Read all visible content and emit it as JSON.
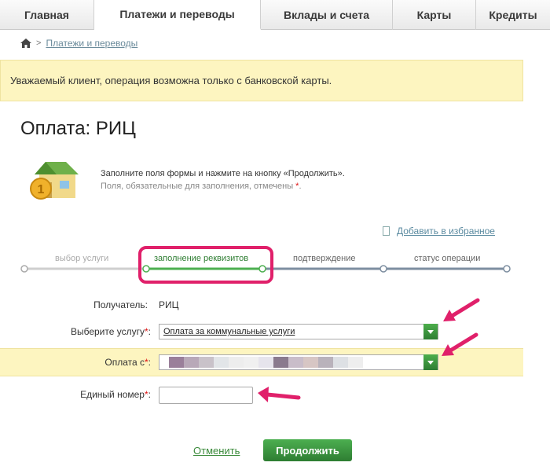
{
  "nav": {
    "tabs": [
      {
        "label": "Главная",
        "active": false
      },
      {
        "label": "Платежи и переводы",
        "active": true
      },
      {
        "label": "Вклады и счета",
        "active": false
      },
      {
        "label": "Карты",
        "active": false
      },
      {
        "label": "Кредиты",
        "active": false
      }
    ]
  },
  "breadcrumb": {
    "home_icon": "home-icon",
    "link": "Платежи и переводы"
  },
  "notice": "Уважаемый клиент, операция возможна только с банковской карты.",
  "page_title": "Оплата: РИЦ",
  "intro": {
    "icon": "house-coin-icon",
    "line1": "Заполните поля формы и нажмите на кнопку «Продолжить».",
    "line2": "Поля, обязательные для заполнения, отмечены",
    "required_mark": "*",
    "line2_end": "."
  },
  "favorite": {
    "icon": "bookmark-icon",
    "label": "Добавить в избранное"
  },
  "steps": [
    {
      "label": "выбор услуги",
      "state": "done"
    },
    {
      "label": "заполнение реквизитов",
      "state": "current"
    },
    {
      "label": "подтверждение",
      "state": "pending"
    },
    {
      "label": "статус операции",
      "state": "pending"
    }
  ],
  "form": {
    "recipient_label": "Получатель:",
    "recipient_value": "РИЦ",
    "service_label": "Выберите услугу",
    "service_value": "Оплата за коммунальные услуги",
    "payfrom_label": "Оплата с",
    "account_label": "Единый номер",
    "required_mark": "*",
    "label_colon": ":"
  },
  "actions": {
    "cancel": "Отменить",
    "continue": "Продолжить"
  },
  "colors": {
    "accent_green": "#2e7d32",
    "highlight_pink": "#e0206a",
    "notice_yellow": "#fdf5c0"
  }
}
